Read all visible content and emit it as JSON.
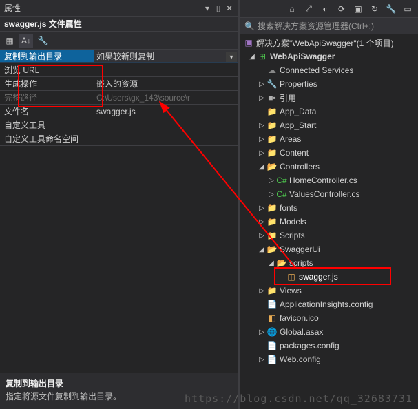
{
  "left": {
    "panel_title": "属性",
    "sub_title": "swagger.js 文件属性",
    "props": [
      {
        "label": "复制到输出目录",
        "value": "如果较新则复制",
        "selected": true,
        "dropdown": true
      },
      {
        "label": "浏览 URL",
        "value": ""
      },
      {
        "label": "生成操作",
        "value": "嵌入的资源"
      },
      {
        "label": "完整路径",
        "value": "C:\\Users\\gx_143\\source\\r",
        "dim": true
      },
      {
        "label": "文件名",
        "value": "swagger.js"
      },
      {
        "label": "自定义工具",
        "value": ""
      },
      {
        "label": "自定义工具命名空间",
        "value": ""
      }
    ],
    "desc": {
      "title": "复制到输出目录",
      "text": "指定将源文件复制到输出目录。"
    }
  },
  "right": {
    "search_placeholder": "搜索解决方案资源管理器(Ctrl+;)",
    "solution_label": "解决方案\"WebApiSwagger\"(1 个项目)",
    "project_name": "WebApiSwagger",
    "nodes": {
      "connected_services": "Connected Services",
      "properties": "Properties",
      "references": "引用",
      "app_data": "App_Data",
      "app_start": "App_Start",
      "areas": "Areas",
      "content": "Content",
      "controllers": "Controllers",
      "home_controller": "HomeController.cs",
      "values_controller": "ValuesController.cs",
      "fonts": "fonts",
      "models": "Models",
      "scripts": "Scripts",
      "swaggerui": "SwaggerUi",
      "scripts_sub": "scripts",
      "swagger_js": "swagger.js",
      "views": "Views",
      "appinsights": "ApplicationInsights.config",
      "favicon": "favicon.ico",
      "global_asax": "Global.asax",
      "packages": "packages.config",
      "web_config": "Web.config"
    }
  },
  "watermark": "https://blog.csdn.net/qq_32683731"
}
